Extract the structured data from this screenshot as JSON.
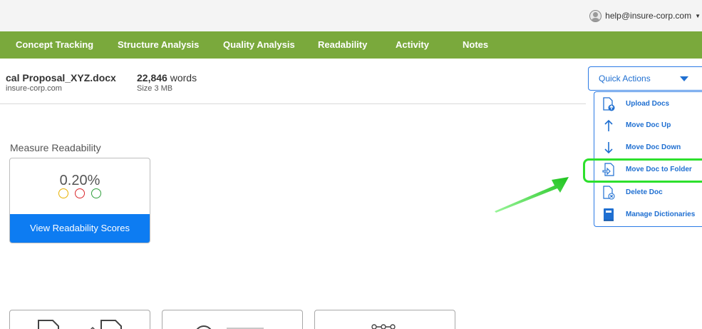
{
  "user": {
    "email": "help@insure-corp.com"
  },
  "nav": {
    "tabs": [
      {
        "label": "Concept Tracking"
      },
      {
        "label": "Structure Analysis"
      },
      {
        "label": "Quality Analysis"
      },
      {
        "label": "Readability"
      },
      {
        "label": "Activity"
      },
      {
        "label": "Notes"
      }
    ]
  },
  "document": {
    "name": "cal Proposal_XYZ.docx",
    "owner": "insure-corp.com",
    "word_count": "22,846",
    "word_unit": "words",
    "size": "Size 3 MB"
  },
  "quick_actions": {
    "label": "Quick Actions",
    "items": [
      {
        "label": "Upload Docs",
        "icon": "upload-doc-icon"
      },
      {
        "label": "Move Doc Up",
        "icon": "arrow-up-icon"
      },
      {
        "label": "Move Doc Down",
        "icon": "arrow-down-icon"
      },
      {
        "label": "Move Doc to Folder",
        "icon": "move-to-folder-icon"
      },
      {
        "label": "Delete Doc",
        "icon": "delete-doc-icon"
      },
      {
        "label": "Manage Dictionaries",
        "icon": "dictionary-icon"
      }
    ],
    "highlighted_item": "Move Doc to Folder"
  },
  "readability": {
    "title": "Measure Readability",
    "score": "0.20%",
    "indicators": [
      "#e8b100",
      "#d9262b",
      "#2e9e3a"
    ],
    "button_label": "View Readability Scores"
  },
  "colors": {
    "nav_green": "#7aa93c",
    "accent_blue": "#0d7cf2",
    "highlight_green": "#2de02d"
  }
}
